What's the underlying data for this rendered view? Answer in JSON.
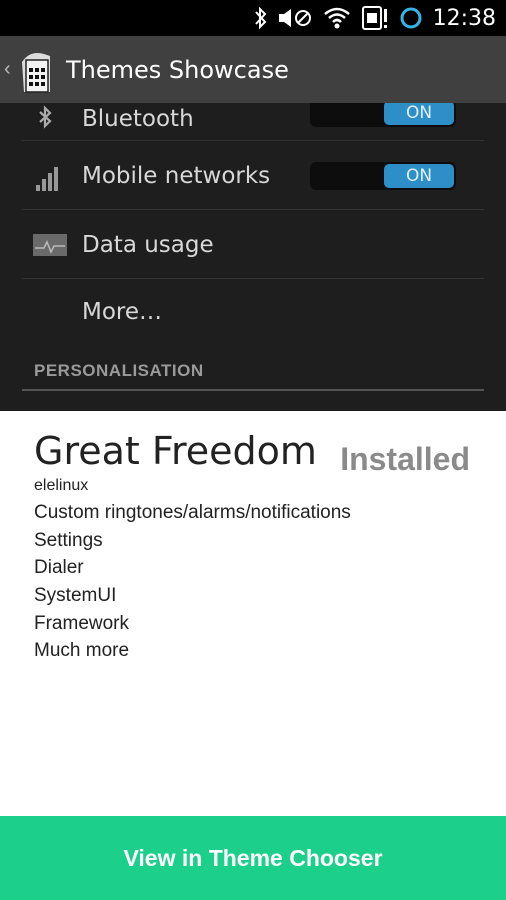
{
  "status_bar": {
    "time": "12:38",
    "icons": [
      "bluetooth-icon",
      "vibrate-icon",
      "wifi-icon",
      "sim-icon",
      "circle-indicator-icon"
    ]
  },
  "action_bar": {
    "back_glyph": "‹",
    "title": "Themes Showcase",
    "app_icon": "phone-icon"
  },
  "preview": {
    "rows": [
      {
        "label": "Bluetooth",
        "icon": "bluetooth-icon",
        "toggle": "ON"
      },
      {
        "label": "Mobile networks",
        "icon": "signal-icon",
        "toggle": "ON"
      },
      {
        "label": "Data usage",
        "icon": "chart-icon"
      },
      {
        "label": "More…"
      }
    ],
    "section_header": "PERSONALISATION"
  },
  "theme": {
    "name": "Great Freedom",
    "status": "Installed",
    "author": "elelinux",
    "features": [
      "Custom ringtones/alarms/notifications",
      "Settings",
      "Dialer",
      "SystemUI",
      "Framework",
      "Much more"
    ]
  },
  "cta": {
    "label": "View in Theme Chooser"
  },
  "colors": {
    "accent": "#1ccf8b",
    "toggle_on": "#2d8ec8",
    "action_bar": "#404040",
    "status_bar": "#000000"
  }
}
